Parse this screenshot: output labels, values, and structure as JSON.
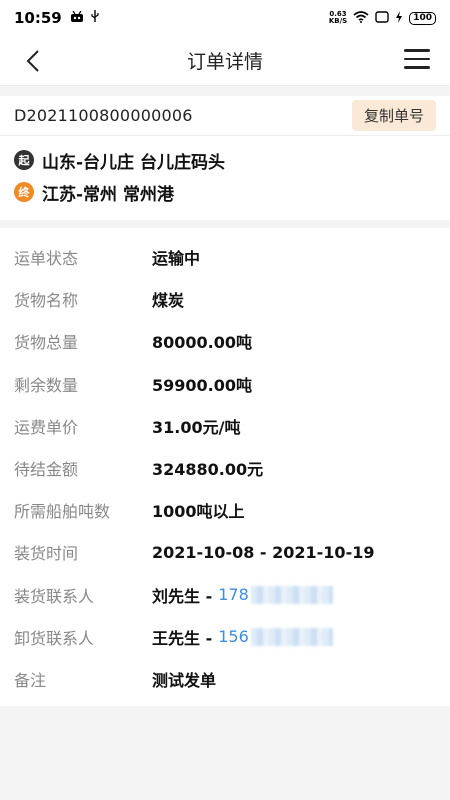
{
  "status_bar": {
    "time": "10:59",
    "net_speed_top": "0.63",
    "net_speed_bottom": "KB/S",
    "battery": "100"
  },
  "nav": {
    "title": "订单详情"
  },
  "order": {
    "number": "D2021100800000006",
    "copy_label": "复制单号"
  },
  "route": {
    "start_badge": "起",
    "start": "山东-台儿庄 台儿庄码头",
    "end_badge": "终",
    "end": "江苏-常州 常州港"
  },
  "details": {
    "status_label": "运单状态",
    "status_value": "运输中",
    "cargo_name_label": "货物名称",
    "cargo_name_value": "煤炭",
    "total_label": "货物总量",
    "total_value": "80000.00吨",
    "remaining_label": "剩余数量",
    "remaining_value": "59900.00吨",
    "unit_price_label": "运费单价",
    "unit_price_value": "31.00元/吨",
    "pending_label": "待结金额",
    "pending_value": "324880.00元",
    "tonnage_label": "所需船舶吨数",
    "tonnage_value": "1000吨以上",
    "loading_time_label": "装货时间",
    "loading_time_value": "2021-10-08 - 2021-10-19",
    "loading_contact_label": "装货联系人",
    "loading_contact_name": "刘先生 -",
    "loading_contact_phone": "178",
    "unloading_contact_label": "卸货联系人",
    "unloading_contact_name": "王先生 -",
    "unloading_contact_phone": "156",
    "remark_label": "备注",
    "remark_value": "测试发单"
  }
}
